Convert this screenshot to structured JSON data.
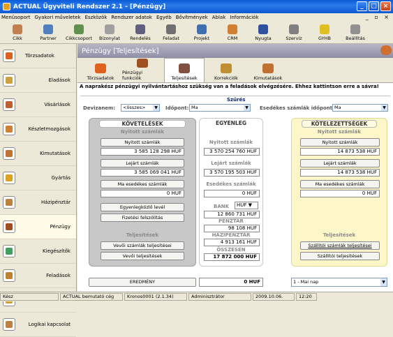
{
  "window": {
    "title": "ACTUAL Ügyviteli Rendszer 2.1 - [Pénzügy]"
  },
  "menu": [
    "Menüsoport",
    "Gyakori műveletek",
    "Eszközök",
    "Rendszer adatok",
    "Egyéb",
    "Bővítmények",
    "Ablak",
    "Információk"
  ],
  "toolbar": [
    "Cikk",
    "Partner",
    "Cikkcsoport",
    "Bizonylat",
    "Rendelés",
    "Feladat",
    "Projekt",
    "CRM",
    "Nyugta",
    "Szerviz",
    "GYHB",
    "Beállítás"
  ],
  "sidebar": [
    "Törzsadatok",
    "Eladások",
    "Vásárlások",
    "Készletmozgások",
    "Kimutatások",
    "Gyártás",
    "Házipénztár",
    "Pénzügy",
    "Kiegészítők",
    "Feladások",
    "Vezetői információ",
    "Logikai kapcsolat"
  ],
  "main": {
    "title": "Pénzügy [Teljesítések]",
    "tabs": [
      "Törzsadatok",
      "Pénzügyi funkciók",
      "Teljesítések",
      "Korrekciók",
      "Kimutatások"
    ],
    "notice": "A naprakész pénzügyi nyilvántartáshoz szükség van a feladások elvégzésére. Ehhez kattintson erre a sávra!"
  },
  "filter": {
    "title": "Szűrés",
    "devizanem_label": "Devizanem:",
    "devizanem_value": "<összes>",
    "idopont_label": "Időpont:",
    "idopont_value": "Ma",
    "esedekes_label": "Esedékes számlák időpont:",
    "esedekes_value": "Ma"
  },
  "kovetelesek": {
    "title": "KÖVETELÉSEK",
    "sub": "Nyitott számlák",
    "btn_nyitott": "Nyitott számlák",
    "val_nyitott": "3 585 128 298 HUF",
    "btn_lejart": "Lejárt számlák",
    "val_lejart": "3 585 069 041 HUF",
    "btn_ma": "Ma esedékes számlák",
    "val_ma": "0 HUF",
    "btn_egyenleg": "Egyenlegközlő levél",
    "btn_fizetesi": "Fizetési felszólítás",
    "sub2": "Teljesítések",
    "btn_vevo_szamlak": "Vevői számlák teljesítései",
    "btn_vevo_telj": "Vevői teljesítések"
  },
  "egyenleg": {
    "title": "EGYENLEG",
    "nyitott_label": "Nyitott számlák",
    "nyitott_val": "3 570 254 760 HUF",
    "lejart_label": "Lejárt számlák",
    "lejart_val": "3 570 195 503 HUF",
    "esedekes_label": "Esedékes számlák",
    "esedekes_val": "0 HUF",
    "bank_label": "BANK",
    "bank_currency": "HUF",
    "bank_val": "12 860 731 HUF",
    "penztar_label": "PÉNZTÁR",
    "penztar_val": "98 108 HUF",
    "hazipenztar_label": "HÁZIPÉNZTÁR",
    "hazipenztar_val": "4 913 161 HUF",
    "osszesen_label": "ÖSSZESEN",
    "osszesen_val": "17 872 000 HUF"
  },
  "kotelezettsegek": {
    "title": "KÖTELEZETTSÉGEK",
    "sub": "Nyitott számlák",
    "btn_nyitott": "Nyitott számlák",
    "val_nyitott": "14 873 538 HUF",
    "btn_lejart": "Lejárt számlák",
    "val_lejart": "14 873 538 HUF",
    "btn_ma": "Ma esedékes számlák",
    "val_ma": "0 HUF",
    "sub2": "Teljesítések",
    "btn_szallito_szamlak": "Szállítói számlák teljesítései",
    "btn_szallito_telj": "Szállítói teljesítések"
  },
  "bottom": {
    "eredmeny": "EREDMÉNY",
    "eredmeny_val": "0 HUF",
    "period": "1 - Mai nap"
  },
  "status": [
    "Kész",
    "ACTUAL bemutató cég",
    "Kronos0001 (2.1.34)",
    "Adminisztrátor",
    "2009.10.06.",
    "12:20"
  ],
  "colors": {
    "titlebar": "#0a5bd9",
    "header": "#9898b0",
    "left_panel": "#c8c8c8",
    "right_panel": "#fdf6c8"
  }
}
